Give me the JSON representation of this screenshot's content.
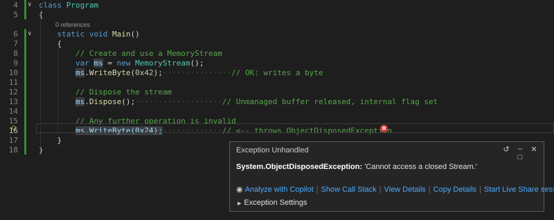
{
  "editor": {
    "references_label": "0 references",
    "lines": [
      {
        "num": "4",
        "tokens": [
          {
            "t": "class ",
            "c": "kw"
          },
          {
            "t": "Program",
            "c": "type"
          }
        ]
      },
      {
        "num": "5",
        "tokens": [
          {
            "t": "{",
            "c": ""
          }
        ]
      },
      {
        "num": "6",
        "tokens": [
          {
            "t": "    ",
            "c": "ws"
          },
          {
            "t": "static ",
            "c": "kw"
          },
          {
            "t": "void ",
            "c": "kw"
          },
          {
            "t": "Main",
            "c": "fn"
          },
          {
            "t": "()",
            "c": ""
          }
        ]
      },
      {
        "num": "7",
        "tokens": [
          {
            "t": "    ",
            "c": "ws"
          },
          {
            "t": "{",
            "c": ""
          }
        ]
      },
      {
        "num": "8",
        "tokens": [
          {
            "t": "        ",
            "c": "ws"
          },
          {
            "t": "// Create and use a MemoryStream",
            "c": "cm"
          }
        ]
      },
      {
        "num": "9",
        "tokens": [
          {
            "t": "        ",
            "c": "ws"
          },
          {
            "t": "var ",
            "c": "kw"
          },
          {
            "t": "ms",
            "c": "var hl"
          },
          {
            "t": " = ",
            "c": ""
          },
          {
            "t": "new ",
            "c": "kw"
          },
          {
            "t": "MemoryStream",
            "c": "type"
          },
          {
            "t": "();",
            "c": ""
          }
        ]
      },
      {
        "num": "10",
        "tokens": [
          {
            "t": "        ",
            "c": "ws"
          },
          {
            "t": "ms",
            "c": "var hl"
          },
          {
            "t": ".",
            "c": ""
          },
          {
            "t": "WriteByte",
            "c": "fn"
          },
          {
            "t": "(",
            "c": ""
          },
          {
            "t": "0x42",
            "c": "num"
          },
          {
            "t": ");",
            "c": ""
          },
          {
            "t": "···············",
            "c": "ws"
          },
          {
            "t": "// OK: writes a byte",
            "c": "cm"
          }
        ]
      },
      {
        "num": "11",
        "tokens": []
      },
      {
        "num": "12",
        "tokens": [
          {
            "t": "        ",
            "c": "ws"
          },
          {
            "t": "// Dispose the stream",
            "c": "cm"
          }
        ]
      },
      {
        "num": "13",
        "tokens": [
          {
            "t": "        ",
            "c": "ws"
          },
          {
            "t": "ms",
            "c": "var hl"
          },
          {
            "t": ".",
            "c": ""
          },
          {
            "t": "Dispose",
            "c": "fn"
          },
          {
            "t": "();",
            "c": ""
          },
          {
            "t": "···················",
            "c": "ws"
          },
          {
            "t": "// Unmanaged buffer released, internal flag set",
            "c": "cm"
          }
        ]
      },
      {
        "num": "14",
        "tokens": []
      },
      {
        "num": "15",
        "tokens": [
          {
            "t": "        ",
            "c": "ws"
          },
          {
            "t": "// Any further operation is invalid",
            "c": "cm"
          }
        ]
      },
      {
        "num": "16",
        "tokens": [
          {
            "t": "        ",
            "c": "ws"
          },
          {
            "t": "ms.WriteByte(0x24);",
            "c": "var hl"
          },
          {
            "t": "·············",
            "c": "ws"
          },
          {
            "t": "// <-- throws ObjectDisposedException",
            "c": "cm"
          }
        ]
      },
      {
        "num": "17",
        "tokens": [
          {
            "t": "    ",
            "c": "ws"
          },
          {
            "t": "}",
            "c": ""
          }
        ]
      },
      {
        "num": "18",
        "tokens": [
          {
            "t": "}",
            "c": ""
          }
        ]
      }
    ],
    "current_line": "16"
  },
  "popup": {
    "title": "Exception Unhandled",
    "exception_type": "System.ObjectDisposedException:",
    "exception_message": " 'Cannot access a closed Stream.'",
    "links": {
      "analyze": "Analyze with Copilot",
      "call_stack": "Show Call Stack",
      "details": "View Details",
      "copy": "Copy Details",
      "live_share": "Start Live Share session"
    },
    "settings_label": "Exception Settings"
  },
  "colors": {
    "background": "#1e1e1e",
    "link": "#4daafc",
    "error": "#d93a3a",
    "change_bar": "#3a8a3a"
  }
}
